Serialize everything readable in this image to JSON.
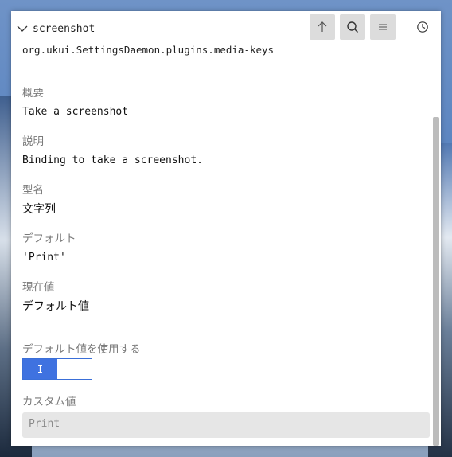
{
  "window": {
    "breadcrumb": "screenshot",
    "key_path": "org.ukui.SettingsDaemon.plugins.media-keys"
  },
  "toolbar": {
    "up_icon": "arrow-up-icon",
    "search_icon": "search-icon",
    "menu_icon": "hamburger-menu-icon",
    "history_icon": "clock-icon"
  },
  "fields": {
    "summary": {
      "label": "概要",
      "value": "Take a screenshot"
    },
    "description": {
      "label": "説明",
      "value": "Binding to take a screenshot."
    },
    "type": {
      "label": "型名",
      "value": "文字列"
    },
    "default": {
      "label": "デフォルト",
      "value": "'Print'"
    },
    "current": {
      "label": "現在値",
      "value": "デフォルト値"
    }
  },
  "use_default": {
    "label": "デフォルト値を使用する",
    "toggle_on_text": "I",
    "enabled": true
  },
  "custom_value": {
    "label": "カスタム値",
    "value": "Print"
  },
  "colors": {
    "accent": "#3f72e0",
    "label": "#7a7a7a",
    "input_bg": "#e6e6e6"
  }
}
